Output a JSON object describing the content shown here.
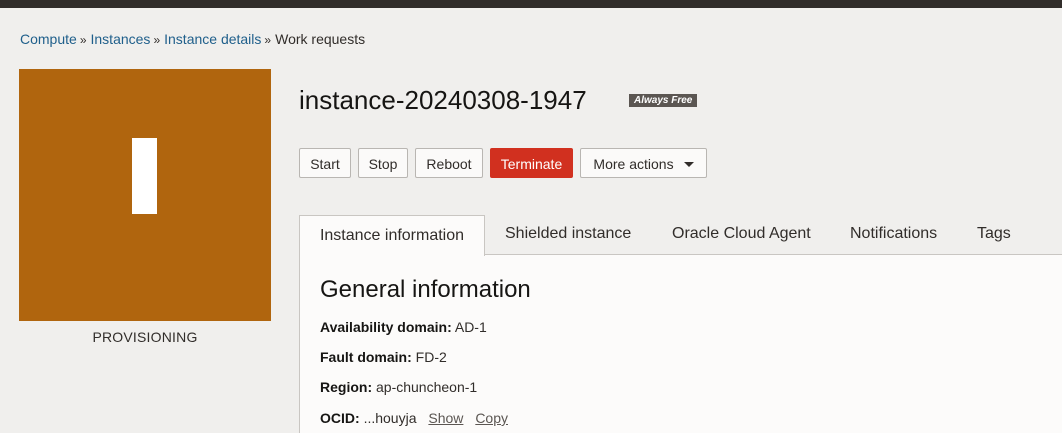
{
  "breadcrumb": {
    "items": [
      {
        "label": "Compute"
      },
      {
        "label": "Instances"
      },
      {
        "label": "Instance details"
      }
    ],
    "separator": "»",
    "current": "Work requests"
  },
  "status": {
    "label": "PROVISIONING",
    "color": "#b0650e"
  },
  "instance": {
    "name": "instance-20240308-1947",
    "badge": "Always Free"
  },
  "actions": {
    "start": "Start",
    "stop": "Stop",
    "reboot": "Reboot",
    "terminate": "Terminate",
    "more": "More actions"
  },
  "tabs": [
    {
      "label": "Instance information",
      "active": true
    },
    {
      "label": "Shielded instance"
    },
    {
      "label": "Oracle Cloud Agent"
    },
    {
      "label": "Notifications"
    },
    {
      "label": "Tags"
    }
  ],
  "general": {
    "title": "General information",
    "availability_domain": {
      "key": "Availability domain:",
      "value": "AD-1"
    },
    "fault_domain": {
      "key": "Fault domain:",
      "value": "FD-2"
    },
    "region": {
      "key": "Region:",
      "value": "ap-chuncheon-1"
    },
    "ocid": {
      "key": "OCID:",
      "value": "...houyja",
      "show": "Show",
      "copy": "Copy"
    }
  },
  "colors": {
    "accent_link": "#1f5f8b",
    "danger": "#d1301f",
    "status_provisioning": "#b0650e"
  }
}
